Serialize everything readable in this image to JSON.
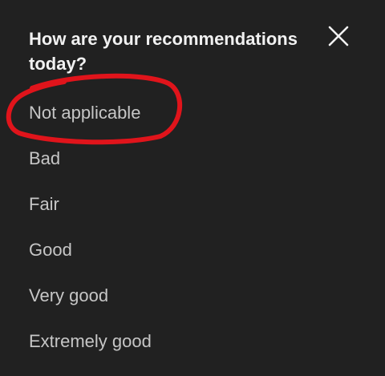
{
  "dialog": {
    "title": "How are your recommendations today?",
    "close_icon": "close-icon",
    "options": [
      {
        "label": "Not applicable"
      },
      {
        "label": "Bad"
      },
      {
        "label": "Fair"
      },
      {
        "label": "Good"
      },
      {
        "label": "Very good"
      },
      {
        "label": "Extremely good"
      }
    ]
  },
  "colors": {
    "background": "#212121",
    "title_text": "#f1f1f1",
    "option_text": "#c6c6c6",
    "annotation_circle": "#e0141b"
  }
}
